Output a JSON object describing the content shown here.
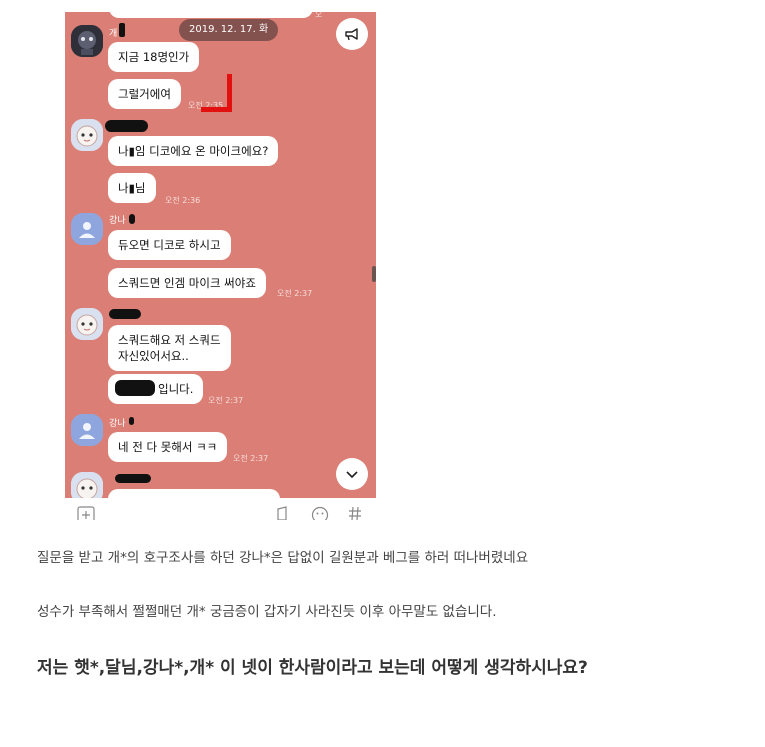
{
  "chat": {
    "date": "2019. 12. 17. 화",
    "messages": {
      "m1": "지금 18명인가",
      "m2": "그럴거에여",
      "m3": "나▮임 디코에요 온 마이크에요?",
      "m4": "나▮님",
      "m5": "듀오면 디코로 하시고",
      "m6": "스쿼드면 인겜 마이크 써야죠",
      "m7a": "스쿼드해요 저 스쿼드",
      "m7b": "자신있어서요..",
      "m8": "입니다.",
      "m9": "네 전 다 못해서 ㅋㅋ"
    },
    "names": {
      "n1": "개",
      "n3": "강나"
    },
    "times": {
      "t1": "오전 2:35",
      "t2": "오전 2:36",
      "t3": "오전 2:37",
      "t4": "오전 2:37",
      "t5": "오전 2:37"
    },
    "icons": [
      "announcement-icon",
      "chevron-down-icon",
      "add-icon",
      "emoji-icon",
      "hash-icon",
      "person-icon"
    ]
  },
  "post": {
    "line1": "질문을 받고 개*의 호구조사를 하던 강나*은 답없이 길원분과 베그를 하러 떠나버렸네요",
    "line2": "성수가 부족해서 쩔쩔매던 개* 궁금증이 갑자기 사라진듯 이후 아무말도 없습니다.",
    "question": "저는 햇*,달님,강나*,개* 이 넷이 한사람이라고 보는데 어떻게 생각하시나요?"
  },
  "colors": {
    "chat_bg": "#db7f76",
    "bubble": "#ffffff",
    "red_mark": "#e2100f"
  }
}
